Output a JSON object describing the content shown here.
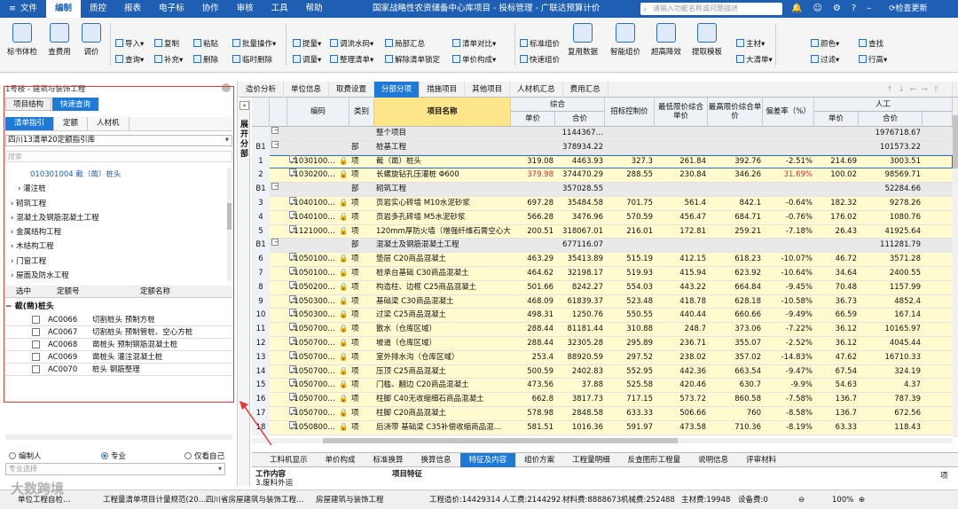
{
  "colors": {
    "title_bg": "#1e5fb3",
    "accent": "#1e7ad6",
    "highlight_header": "#fde58a",
    "item_row": "#fffbcf",
    "red_text": "#d32f2f",
    "annotation_red": "#e53935"
  },
  "titlebar": {
    "menu": [
      "文件",
      "编制",
      "报表",
      "电子标",
      "协作",
      "审核",
      "工具",
      "帮助"
    ],
    "menu_prefix": "≡",
    "menu_active": "编制",
    "quality_label": "质控",
    "title": "国家战略性农资储备中心库项目 - 投标管理 - 广联达预算计价",
    "search_placeholder": "请输入功能名称或问题描述",
    "update": "检查更新"
  },
  "ribbon": {
    "big": [
      "标书体检",
      "查费用",
      "调价"
    ],
    "col1": [
      "导入",
      "查询"
    ],
    "col2": [
      "复制",
      "补充"
    ],
    "col3": [
      "粘贴",
      "删除"
    ],
    "col4": [
      "批量操作",
      "临时删除"
    ],
    "col5": [
      "提量",
      "调量"
    ],
    "col6": [
      "调流水码",
      "整理清单"
    ],
    "col7": [
      "局部汇总",
      "解除清单锁定"
    ],
    "col8": [
      "清单对比",
      "单价构成"
    ],
    "col9": [
      "标准组价",
      "快速组价"
    ],
    "big2": [
      "复用数据",
      "智能组价",
      "超高降效",
      "提取模板"
    ],
    "col10": [
      "主材",
      "大清单"
    ],
    "col11": [
      "颜色",
      "过滤"
    ],
    "col12": [
      "查找",
      "行高"
    ]
  },
  "left": {
    "header": "1号楼 - 建筑与装饰工程",
    "tabs1": [
      "项目结构",
      "快速查询"
    ],
    "tabs1_active": "快速查询",
    "tabs2": [
      "清单指引",
      "定额",
      "人材机"
    ],
    "tabs2_active": "清单指引",
    "library": "四川13清单20定额指引库",
    "search_placeholder": "搜索",
    "tree": [
      {
        "t": "010301004  截（凿）桩头",
        "lv": "sel"
      },
      {
        "t": "› 灌注桩",
        "lv": "sub"
      },
      {
        "t": "› 砌筑工程",
        "lv": "top"
      },
      {
        "t": "› 混凝土及钢筋混凝土工程",
        "lv": "top"
      },
      {
        "t": "› 金属结构工程",
        "lv": "top"
      },
      {
        "t": "› 木结构工程",
        "lv": "top"
      },
      {
        "t": "› 门窗工程",
        "lv": "top"
      },
      {
        "t": "› 屋面及防水工程",
        "lv": "top"
      }
    ],
    "quota_header": [
      "选中",
      "定额号",
      "定额名称"
    ],
    "quota_group": "截(凿)桩头",
    "quota_rows": [
      [
        "AC0066",
        "切割桩头 预制方桩"
      ],
      [
        "AC0067",
        "切割桩头 预制管桩、空心方桩"
      ],
      [
        "AC0068",
        "凿桩头 预制钢筋混凝土桩"
      ],
      [
        "AC0069",
        "凿桩头 灌注混凝土桩"
      ],
      [
        "AC0070",
        "桩头 钢筋整理"
      ]
    ],
    "radios": [
      "编制人",
      "专业",
      "仅看自己"
    ],
    "radio_on": "专业",
    "pro_placeholder": "专业选择"
  },
  "collapse_label": "展开分部",
  "main": {
    "tabs": [
      "造价分析",
      "单位信息",
      "取费设置",
      "分部分项",
      "措施项目",
      "其他项目",
      "人材机汇总",
      "费用汇总"
    ],
    "tab_active": "分部分项",
    "headers": {
      "code": "编码",
      "type": "类别",
      "name": "项目名称",
      "composite": "综合",
      "unit_price": "单价",
      "total": "合价",
      "bid_ctrl": "招标控制价",
      "min_limit": "最低限价综合单价",
      "max_limit": "最高限价综合单价",
      "deviation": "偏差率（%）",
      "labor": "人工"
    },
    "rows": [
      {
        "no": "",
        "code": "",
        "type": "",
        "name": "整个项目",
        "p": "",
        "t": "1144367…",
        "b": "",
        "mn": "",
        "mx": "",
        "d": "",
        "lp": "",
        "lt": "1976718.67",
        "k": "sec"
      },
      {
        "no": "B1",
        "code": "",
        "type": "部",
        "name": "桩基工程",
        "p": "",
        "t": "378934.22",
        "b": "",
        "mn": "",
        "mx": "",
        "d": "",
        "lp": "",
        "lt": "101573.22",
        "k": "sec"
      },
      {
        "no": "1",
        "code": "01030100…",
        "type": "项",
        "name": "截（凿）桩头",
        "p": "319.08",
        "t": "4463.93",
        "b": "327.3",
        "mn": "261.84",
        "mx": "392.76",
        "d": "-2.51%",
        "lp": "214.69",
        "lt": "3003.51",
        "k": "cur"
      },
      {
        "no": "2",
        "code": "01030200…",
        "type": "项",
        "name": "长螺旋钻孔压灌桩 Φ600",
        "p": "379.98",
        "t": "374470.29",
        "b": "288.55",
        "mn": "230.84",
        "mx": "346.26",
        "d": "31.69%",
        "lp": "100.02",
        "lt": "98569.71",
        "k": "item",
        "red": true
      },
      {
        "no": "B1",
        "code": "",
        "type": "部",
        "name": "砌筑工程",
        "p": "",
        "t": "357028.55",
        "b": "",
        "mn": "",
        "mx": "",
        "d": "",
        "lp": "",
        "lt": "52284.66",
        "k": "sec"
      },
      {
        "no": "3",
        "code": "01040100…",
        "type": "项",
        "name": "页岩实心砖墙 M10水泥砂浆",
        "p": "697.28",
        "t": "35484.58",
        "b": "701.75",
        "mn": "561.4",
        "mx": "842.1",
        "d": "-0.64%",
        "lp": "182.32",
        "lt": "9278.26",
        "k": "item"
      },
      {
        "no": "4",
        "code": "01040100…",
        "type": "项",
        "name": "页岩多孔砖墙 M5水泥砂浆",
        "p": "566.28",
        "t": "3476.96",
        "b": "570.59",
        "mn": "456.47",
        "mx": "684.71",
        "d": "-0.76%",
        "lp": "176.02",
        "lt": "1080.76",
        "k": "item"
      },
      {
        "no": "5",
        "code": "01121000…",
        "type": "项",
        "name": "120mm厚防火墙（增强纤维石膏空心大…",
        "p": "200.51",
        "t": "318067.01",
        "b": "216.01",
        "mn": "172.81",
        "mx": "259.21",
        "d": "-7.18%",
        "lp": "26.43",
        "lt": "41925.64",
        "k": "item"
      },
      {
        "no": "B1",
        "code": "",
        "type": "部",
        "name": "混凝土及钢筋混凝土工程",
        "p": "",
        "t": "677116.07",
        "b": "",
        "mn": "",
        "mx": "",
        "d": "",
        "lp": "",
        "lt": "111281.79",
        "k": "sec"
      },
      {
        "no": "6",
        "code": "01050100…",
        "type": "项",
        "name": "垫层 C20商品混凝土",
        "p": "463.29",
        "t": "35413.89",
        "b": "515.19",
        "mn": "412.15",
        "mx": "618.23",
        "d": "-10.07%",
        "lp": "46.72",
        "lt": "3571.28",
        "k": "item"
      },
      {
        "no": "7",
        "code": "01050100…",
        "type": "项",
        "name": "桩承台基础 C30商品混凝土",
        "p": "464.62",
        "t": "32198.17",
        "b": "519.93",
        "mn": "415.94",
        "mx": "623.92",
        "d": "-10.64%",
        "lp": "34.64",
        "lt": "2400.55",
        "k": "item"
      },
      {
        "no": "8",
        "code": "01050200…",
        "type": "项",
        "name": "构造柱、边框 C25商品混凝土",
        "p": "501.66",
        "t": "8242.27",
        "b": "554.03",
        "mn": "443.22",
        "mx": "664.84",
        "d": "-9.45%",
        "lp": "70.48",
        "lt": "1157.99",
        "k": "item"
      },
      {
        "no": "9",
        "code": "01050300…",
        "type": "项",
        "name": "基础梁 C30商品混凝土",
        "p": "468.09",
        "t": "61839.37",
        "b": "523.48",
        "mn": "418.78",
        "mx": "628.18",
        "d": "-10.58%",
        "lp": "36.73",
        "lt": "4852.4",
        "k": "item"
      },
      {
        "no": "10",
        "code": "01050300…",
        "type": "项",
        "name": "过梁 C25商品混凝土",
        "p": "498.31",
        "t": "1250.76",
        "b": "550.55",
        "mn": "440.44",
        "mx": "660.66",
        "d": "-9.49%",
        "lp": "66.59",
        "lt": "167.14",
        "k": "item"
      },
      {
        "no": "11",
        "code": "01050700…",
        "type": "项",
        "name": "散水（仓库区域）",
        "p": "288.44",
        "t": "81181.44",
        "b": "310.88",
        "mn": "248.7",
        "mx": "373.06",
        "d": "-7.22%",
        "lp": "36.12",
        "lt": "10165.97",
        "k": "item"
      },
      {
        "no": "12",
        "code": "01050700…",
        "type": "项",
        "name": "坡道（仓库区域）",
        "p": "288.44",
        "t": "32305.28",
        "b": "295.89",
        "mn": "236.71",
        "mx": "355.07",
        "d": "-2.52%",
        "lp": "36.12",
        "lt": "4045.44",
        "k": "item"
      },
      {
        "no": "13",
        "code": "01050700…",
        "type": "项",
        "name": "室外排水沟（仓库区域）",
        "p": "253.4",
        "t": "88920.59",
        "b": "297.52",
        "mn": "238.02",
        "mx": "357.02",
        "d": "-14.83%",
        "lp": "47.62",
        "lt": "16710.33",
        "k": "item"
      },
      {
        "no": "14",
        "code": "01050700…",
        "type": "项",
        "name": "压顶 C25商品混凝土",
        "p": "500.59",
        "t": "2402.83",
        "b": "552.95",
        "mn": "442.36",
        "mx": "663.54",
        "d": "-9.47%",
        "lp": "67.54",
        "lt": "324.19",
        "k": "item"
      },
      {
        "no": "15",
        "code": "01050700…",
        "type": "项",
        "name": "门槛、翻边 C20商品混凝土",
        "p": "473.56",
        "t": "37.88",
        "b": "525.58",
        "mn": "420.46",
        "mx": "630.7",
        "d": "-9.9%",
        "lp": "54.63",
        "lt": "4.37",
        "k": "item"
      },
      {
        "no": "16",
        "code": "01050700…",
        "type": "项",
        "name": "柱脚 C40无收缩细石商品混凝土",
        "p": "662.8",
        "t": "3817.73",
        "b": "717.15",
        "mn": "573.72",
        "mx": "860.58",
        "d": "-7.58%",
        "lp": "136.7",
        "lt": "787.39",
        "k": "item"
      },
      {
        "no": "17",
        "code": "01050700…",
        "type": "项",
        "name": "柱脚 C20商品混凝土",
        "p": "578.98",
        "t": "2848.58",
        "b": "633.33",
        "mn": "506.66",
        "mx": "760",
        "d": "-8.58%",
        "lp": "136.7",
        "lt": "672.56",
        "k": "item"
      },
      {
        "no": "18",
        "code": "01050800…",
        "type": "项",
        "name": "后浇带 基础梁 C35补偿收缩商品混…",
        "p": "581.51",
        "t": "1016.36",
        "b": "591.97",
        "mn": "473.58",
        "mx": "710.36",
        "d": "-8.19%",
        "lp": "63.33",
        "lt": "118.43",
        "k": "item"
      }
    ]
  },
  "bottom_tabs": [
    "工料机显示",
    "单价构成",
    "标准换算",
    "换算信息",
    "特征及内容",
    "组价方案",
    "工程量明细",
    "反查图形工程量",
    "说明信息",
    "评审材料"
  ],
  "bottom_active": "特征及内容",
  "bottom_panel": {
    "col1": "工作内容",
    "col2": "项目特征",
    "line": "3.废料外运",
    "right": "项"
  },
  "status": {
    "items": [
      "单位工程自检…",
      "工程量清单项目计量规范(20…",
      "四川省房屋建筑与装饰工程…",
      "房屋建筑与装饰工程",
      "工程造价:14429314",
      "人工费:2144292",
      "材料费:8888673",
      "机械费:252488",
      "主材费:19948",
      "设备费:0"
    ],
    "zoom": "100%"
  },
  "watermark": "大数跨境"
}
